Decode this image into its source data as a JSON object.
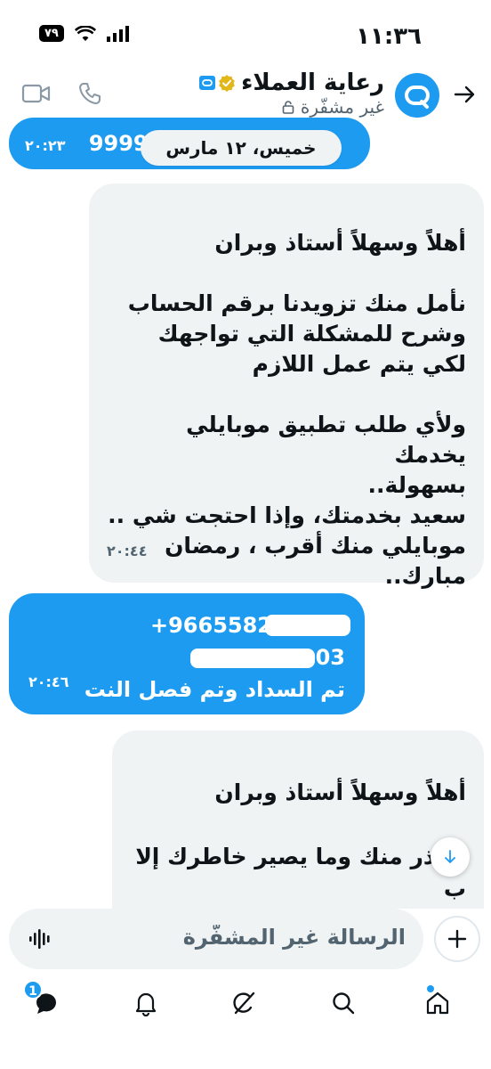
{
  "status_bar": {
    "time": "١١:٣٦",
    "battery": "٧٩"
  },
  "header": {
    "title": "رعاية العملاء",
    "subtitle": "غير مشفّرة",
    "icons": [
      "back-arrow-icon",
      "verified-icon",
      "lock-icon",
      "phone-icon",
      "video-icon"
    ]
  },
  "messages": [
    {
      "direction": "sent",
      "text": "999999",
      "time": "٢٠:٢٣"
    },
    {
      "direction": "received",
      "text": "أهلاً وسهلاً أستاذ  وبران\n\nنأمل منك تزويدنا برقم الحساب\nوشرح للمشكلة التي تواجهك\nلكي يتم عمل اللازم\n\nولأي طلب تطبيق موبايلي يخدمك\nبسهولة..\nسعيد بخدمتك، وإذا احتجت شي ..\nموبايلي منك أقرب ، رمضان\nمبارك..",
      "time": "٢٠:٤٤"
    },
    {
      "direction": "sent",
      "line1": "+9665582",
      "line2": "03",
      "line3": "تم السداد وتم فصل النت",
      "time": "٢٠:٤٦"
    },
    {
      "direction": "received",
      "text": "أهلاً وسهلاً أستاذ وبران\n\nنعتذر منك وما يصير خاطرك إلا\nب"
    }
  ],
  "date_separator": "خميس، ١٢ مارس",
  "composer": {
    "placeholder": "الرسالة غير المشفّرة"
  },
  "bottom_nav": {
    "items": [
      "home-icon",
      "search-icon",
      "grok-icon",
      "notifications-icon",
      "messages-icon"
    ],
    "messages_badge": "1"
  },
  "colors": {
    "accent": "#1d9bf0",
    "received_bubble": "#eff3f4",
    "secondary_text": "#536471"
  }
}
